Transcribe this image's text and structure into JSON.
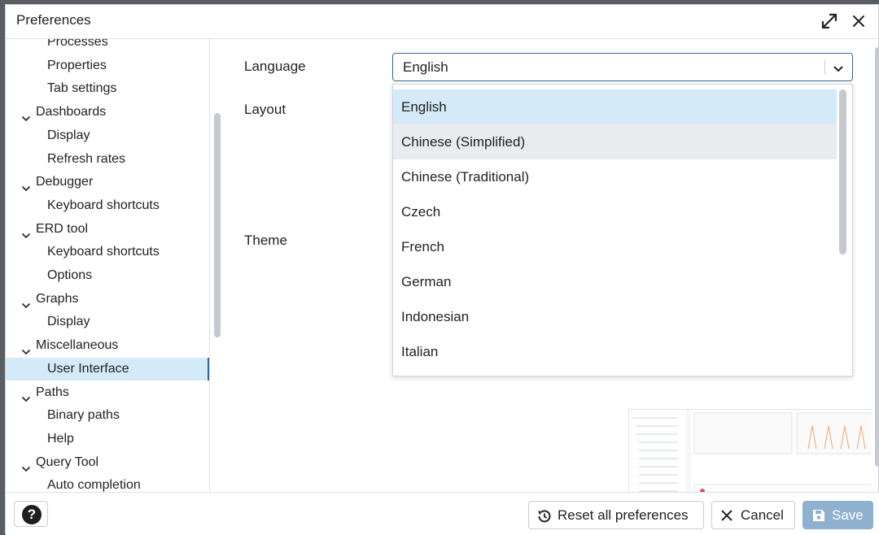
{
  "dialog": {
    "title": "Preferences"
  },
  "tree": {
    "items": [
      {
        "label": "Processes",
        "type": "child"
      },
      {
        "label": "Properties",
        "type": "child"
      },
      {
        "label": "Tab settings",
        "type": "child"
      },
      {
        "label": "Dashboards",
        "type": "parent"
      },
      {
        "label": "Display",
        "type": "child"
      },
      {
        "label": "Refresh rates",
        "type": "child"
      },
      {
        "label": "Debugger",
        "type": "parent"
      },
      {
        "label": "Keyboard shortcuts",
        "type": "child"
      },
      {
        "label": "ERD tool",
        "type": "parent"
      },
      {
        "label": "Keyboard shortcuts",
        "type": "child"
      },
      {
        "label": "Options",
        "type": "child"
      },
      {
        "label": "Graphs",
        "type": "parent"
      },
      {
        "label": "Display",
        "type": "child"
      },
      {
        "label": "Miscellaneous",
        "type": "parent"
      },
      {
        "label": "User Interface",
        "type": "child",
        "selected": true
      },
      {
        "label": "Paths",
        "type": "parent"
      },
      {
        "label": "Binary paths",
        "type": "child"
      },
      {
        "label": "Help",
        "type": "child"
      },
      {
        "label": "Query Tool",
        "type": "parent"
      },
      {
        "label": "Auto completion",
        "type": "child"
      }
    ]
  },
  "form": {
    "language_label": "Language",
    "layout_label": "Layout",
    "theme_label": "Theme",
    "language_value": "English"
  },
  "language_menu": {
    "options": [
      "English",
      "Chinese (Simplified)",
      "Chinese (Traditional)",
      "Czech",
      "French",
      "German",
      "Indonesian",
      "Italian"
    ],
    "selected": "English",
    "hovered": "Chinese (Simplified)"
  },
  "footer": {
    "help_label": "?",
    "reset_label": "Reset all preferences",
    "cancel_label": "Cancel",
    "save_label": "Save"
  },
  "colors": {
    "accent": "#326690",
    "selected_bg": "#d4eaf8",
    "save_disabled": "#8fb1cf"
  }
}
